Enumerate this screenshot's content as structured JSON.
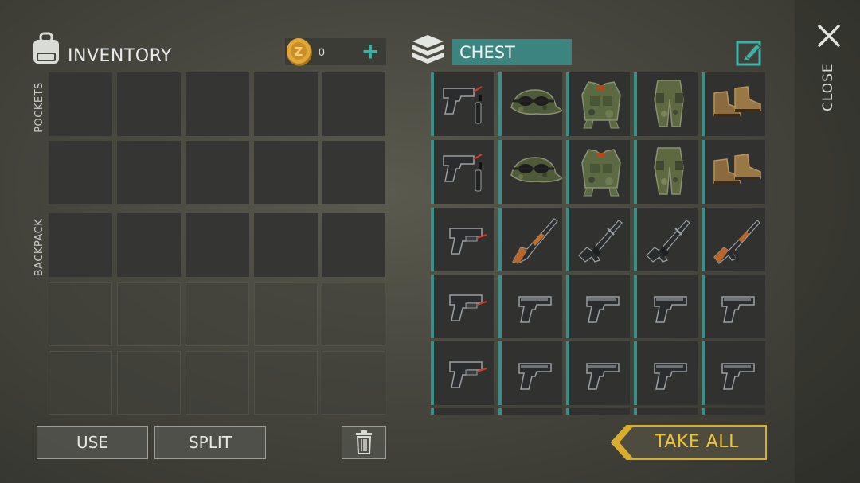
{
  "inventory": {
    "title": "INVENTORY",
    "coins": "0",
    "add_coins_symbol": "+",
    "pockets_label": "POCKETS",
    "backpack_label": "BACKPACK"
  },
  "chest": {
    "title": "CHEST",
    "items": [
      [
        "pistol-with-silencer-icon",
        "military-cap-with-goggles-icon",
        "camo-tactical-vest-icon",
        "camo-pants-icon",
        "boots-icon"
      ],
      [
        "pistol-with-silencer-icon",
        "military-cap-with-goggles-icon",
        "camo-tactical-vest-icon",
        "camo-pants-icon",
        "boots-icon"
      ],
      [
        "pistol-with-laser-icon",
        "shotgun-icon",
        "assault-rifle-icon",
        "assault-rifle-icon",
        "ak-rifle-icon"
      ],
      [
        "pistol-with-laser-icon",
        "pistol-icon",
        "pistol-icon",
        "pistol-icon",
        "pistol-icon"
      ],
      [
        "pistol-with-laser-icon",
        "pistol-icon",
        "pistol-icon",
        "pistol-icon",
        "pistol-icon"
      ]
    ]
  },
  "actions": {
    "use_label": "USE",
    "split_label": "SPLIT",
    "take_all_label": "TAKE ALL",
    "close_label": "CLOSE"
  },
  "colors": {
    "accent": "#3b8480",
    "take_all": "#f0c236",
    "slot": "#353633"
  }
}
